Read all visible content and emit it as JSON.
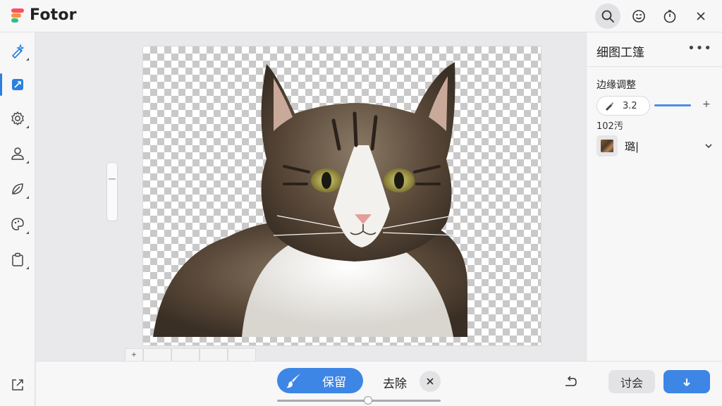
{
  "app": {
    "name": "Fotor"
  },
  "colors": {
    "accent": "#3d86e6",
    "topbar_bg": "#f7f7f8",
    "canvas_bg": "#e9e9eb"
  },
  "topbar": {
    "icons": [
      "search-icon",
      "emoji-icon",
      "timer-icon",
      "close-icon"
    ]
  },
  "sidebar": {
    "items": [
      {
        "icon": "magic-wand-icon"
      },
      {
        "icon": "crop-icon",
        "active": true
      },
      {
        "icon": "settings-gear-icon"
      },
      {
        "icon": "person-icon"
      },
      {
        "icon": "leaf-icon"
      },
      {
        "icon": "palette-icon"
      },
      {
        "icon": "clipboard-icon"
      }
    ],
    "bottom_icon": "export-icon"
  },
  "canvas": {
    "subject": "cat-cutout-image",
    "background": "transparent-checkerboard"
  },
  "right_panel": {
    "title": "细图工篷",
    "more_label": "•••",
    "edge_label": "边缘调整",
    "brush_value": "3.2",
    "plus_label": "+",
    "small_label": "102汚",
    "bg_name": "璐|"
  },
  "bottombar": {
    "keep_label": "保留",
    "remove_label": "去除",
    "cancel_label": "讨会"
  },
  "canvas_strip": {
    "plus_label": "+"
  }
}
